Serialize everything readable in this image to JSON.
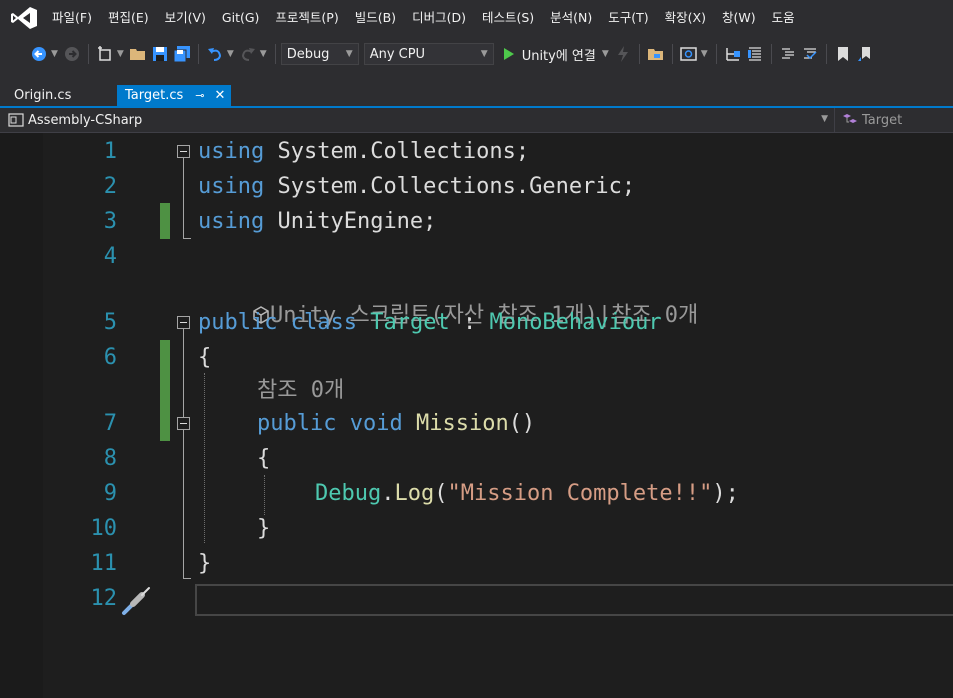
{
  "menu": [
    "파일(F)",
    "편집(E)",
    "보기(V)",
    "Git(G)",
    "프로젝트(P)",
    "빌드(B)",
    "디버그(D)",
    "테스트(S)",
    "분석(N)",
    "도구(T)",
    "확장(X)",
    "창(W)",
    "도움"
  ],
  "toolbar": {
    "config": "Debug",
    "platform": "Any CPU",
    "run_label": "Unity에 연결"
  },
  "tabs": {
    "origin": "Origin.cs",
    "target": "Target.cs",
    "pin_glyph": "⊸",
    "close_glyph": "✕"
  },
  "navbar": {
    "project": "Assembly-CSharp",
    "member": "Target"
  },
  "code": {
    "line_numbers": [
      "1",
      "2",
      "3",
      "4",
      "5",
      "6",
      "7",
      "8",
      "9",
      "10",
      "11",
      "12"
    ],
    "l1": {
      "kw": "using",
      "rest": " System.Collections;"
    },
    "l2": {
      "kw": "using",
      "rest": " System.Collections.Generic;"
    },
    "l3": {
      "kw": "using",
      "rest": " UnityEngine;"
    },
    "lens1": "Unity 스크립트(자산 참조 1개)|참조 0개",
    "l5": {
      "kw1": "public",
      "kw2": "class",
      "name": "Target",
      "colon": " : ",
      "base": "MonoBehaviour"
    },
    "l6": "{",
    "lens2": "참조 0개",
    "l7": {
      "kw1": "public",
      "kw2": "void",
      "name": "Mission",
      "paren": "()"
    },
    "l8": "{",
    "l9": {
      "cls": "Debug",
      "dot": ".",
      "method": "Log",
      "open": "(",
      "str": "\"Mission Complete!!\"",
      "close": ");"
    },
    "l10": "}",
    "l11": "}"
  },
  "colors": {
    "keyword": "#569cd6",
    "type": "#4ec9b0",
    "method": "#dcdcaa",
    "string": "#d69d85",
    "line_number": "#2b91af",
    "accent": "#007acc"
  }
}
